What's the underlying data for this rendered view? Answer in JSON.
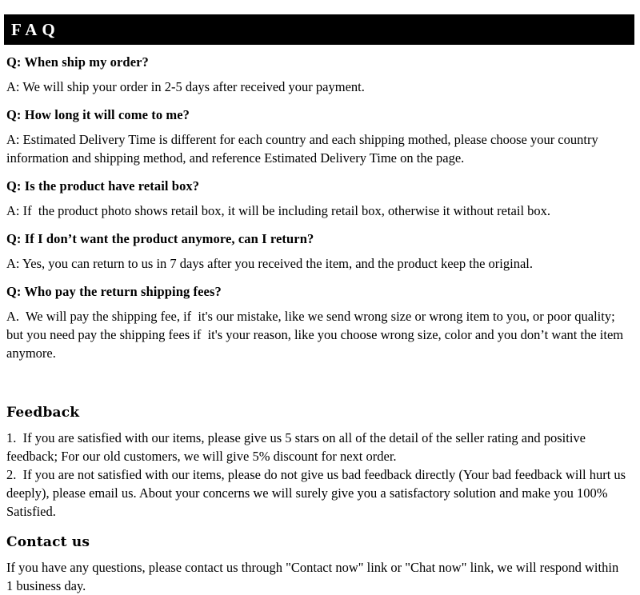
{
  "header": {
    "title": "FAQ"
  },
  "faq": {
    "items": [
      {
        "question": "Q: When ship my order?",
        "answer": "A: We will ship your order in 2-5 days after received your payment."
      },
      {
        "question": "Q: How long it will come to me?",
        "answer": "A: Estimated Delivery Time is different for each country and each shipping mothed, please choose your country information and shipping method, and reference Estimated Delivery Time on the page."
      },
      {
        "question": "Q: Is the product have retail box?",
        "answer": "A: If  the product photo shows retail box, it will be including retail box, otherwise it without retail box."
      },
      {
        "question": "Q: If I don’t want the product anymore, can I return?",
        "answer": "A: Yes, you can return to us in 7 days after you received the item, and the product keep the original."
      },
      {
        "question": "Q: Who pay the return shipping fees?",
        "answer": "A.  We will pay the shipping fee, if  it's our mistake, like we send wrong size or wrong item to you, or poor quality; but you need pay the shipping fees if  it's your reason, like you choose wrong size, color and you don’t want the item anymore."
      }
    ]
  },
  "feedback": {
    "heading": "Feedback",
    "item_1": "1.  If you are satisfied with our items, please give us 5 stars on all of the detail of the seller rating and positive feedback; For our old customers, we will give 5% discount for next order.",
    "item_2": "2.  If you are not satisfied with our items, please do not give us bad feedback directly (Your bad feedback will hurt us deeply), please email us. About your concerns we will surely give you a satisfactory solution and make you 100% Satisfied."
  },
  "contact": {
    "heading": "Contact us",
    "body": "If you have any questions, please contact us through \"Contact now\" link or \"Chat now\" link, we will respond within 1 business day."
  },
  "colors": {
    "header_bar_background": "#000000",
    "header_text": "#ffffff",
    "body_text": "#000000",
    "page_background": "#ffffff"
  }
}
